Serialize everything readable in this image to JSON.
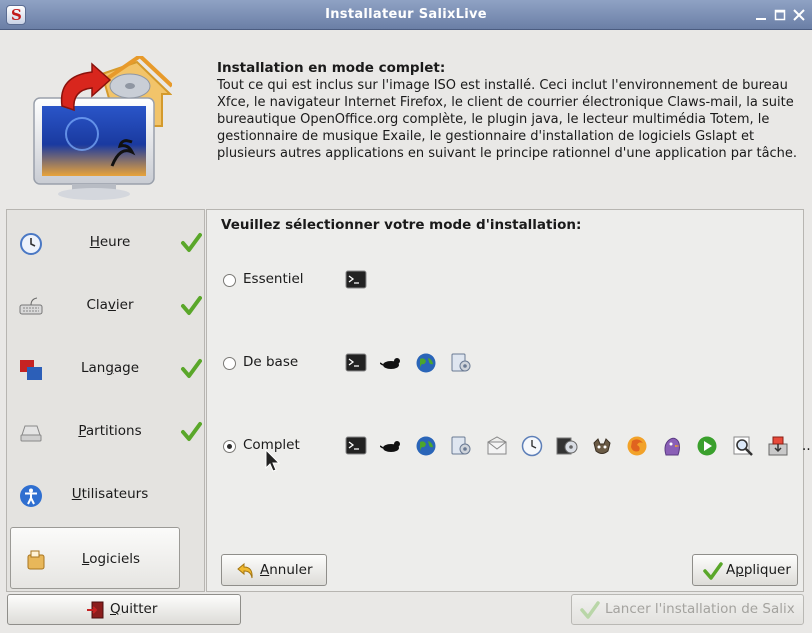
{
  "window": {
    "title": "Installateur SalixLive",
    "controls": [
      "minimize-icon",
      "maximize-icon",
      "close-icon"
    ]
  },
  "header": {
    "title": "Installation en mode complet:",
    "description": "Tout ce qui est inclus sur l'image ISO est installé. Ceci inclut l'environnement de bureau Xfce, le navigateur Internet Firefox, le client de courrier électronique Claws-mail, la suite bureautique OpenOffice.org complète, le plugin java, le lecteur multimédia Totem, le gestionnaire de musique Exaile, le gestionnaire d'installation de logiciels Gslapt et plusieurs autres applications en suivant le principe rationnel d'une application par tâche."
  },
  "sidebar": {
    "items": [
      {
        "label_pre": "",
        "label_key": "H",
        "label_post": "eure",
        "icon": "clock-icon",
        "done": true
      },
      {
        "label_pre": "Cla",
        "label_key": "v",
        "label_post": "ier",
        "icon": "keyboard-icon",
        "done": true
      },
      {
        "label_pre": "Lan",
        "label_key": "g",
        "label_post": "age",
        "icon": "language-flags-icon",
        "done": true
      },
      {
        "label_pre": "",
        "label_key": "P",
        "label_post": "artitions",
        "icon": "hard-drive-icon",
        "done": true
      },
      {
        "label_pre": "",
        "label_key": "U",
        "label_post": "tilisateurs",
        "icon": "user-accessibility-icon",
        "done": false
      },
      {
        "label_pre": "",
        "label_key": "L",
        "label_post": "ogiciels",
        "icon": "software-package-icon",
        "done": false,
        "active": true
      }
    ]
  },
  "main": {
    "heading": "Veuillez sélectionner votre mode d'installation:",
    "options": [
      {
        "label": "Essentiel",
        "selected": false,
        "icons": [
          "terminal-icon"
        ]
      },
      {
        "label": "De base",
        "selected": false,
        "icons": [
          "terminal-icon",
          "xfce-mouse-icon",
          "globe-icon",
          "settings-manager-icon"
        ]
      },
      {
        "label": "Complet",
        "selected": true,
        "icons": [
          "terminal-icon",
          "xfce-mouse-icon",
          "globe-icon",
          "settings-manager-icon",
          "mail-icon",
          "clock-applet-icon",
          "media-player-icon",
          "gimp-icon",
          "firefox-icon",
          "pidgin-icon",
          "play-icon",
          "search-magnifier-icon",
          "package-installer-icon"
        ],
        "more": "..."
      }
    ]
  },
  "buttons": {
    "cancel": {
      "pre": "",
      "key": "A",
      "post": "nnuler"
    },
    "apply": {
      "pre": "A",
      "key": "p",
      "post": "pliquer"
    },
    "quit": {
      "pre": "",
      "key": "Q",
      "post": "uitter"
    },
    "launch": {
      "label": "Lancer l'installation de Salix",
      "enabled": false
    }
  }
}
